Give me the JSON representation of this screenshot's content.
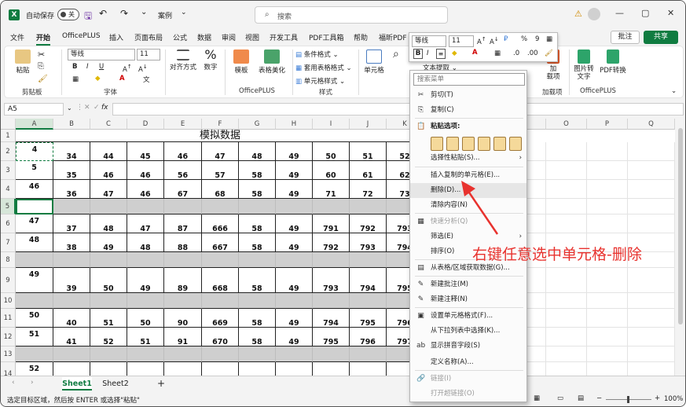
{
  "app": {
    "autosave_label": "自动保存",
    "autosave_state": "关",
    "file_name": "案例",
    "search_placeholder": "搜索",
    "window_buttons": [
      "—",
      "▢",
      "✕"
    ]
  },
  "menu": {
    "items": [
      "文件",
      "开始",
      "OfficePLUS",
      "插入",
      "页面布局",
      "公式",
      "数据",
      "审阅",
      "视图",
      "开发工具",
      "PDF工具箱",
      "帮助",
      "福昕PDF"
    ],
    "active": "开始",
    "comment_label": "批注",
    "share_label": "共享"
  },
  "ribbon": {
    "paste_label": "粘贴",
    "clipboard_label": "剪贴板",
    "font_name": "等线",
    "font_size": "11",
    "font_label": "字体",
    "alignment_label": "对齐方式",
    "number_label": "数字",
    "template_label": "模板",
    "table_beautify_label": "表格美化",
    "officeplus_label": "OfficePLUS",
    "conditional_format": "条件格式",
    "table_format": "套用表格格式",
    "cell_style": "单元格样式",
    "styles_label": "样式",
    "cells_label": "单元格",
    "text_extract": "文本提取",
    "load_items": "加\n载项",
    "load_items_label": "加载项",
    "image_to_text": "图片转\n文字",
    "pdf_convert": "PDF转换",
    "officeplus_label2": "OfficePLUS"
  },
  "mini_toolbar": {
    "font_name": "等线",
    "font_size": "11",
    "bold": "B",
    "italic": "I"
  },
  "formula_bar": {
    "name_box": "A5",
    "fx": "fx"
  },
  "sheet": {
    "columns": [
      "A",
      "B",
      "C",
      "D",
      "E",
      "F",
      "G",
      "H",
      "I",
      "J",
      "K",
      "L",
      "M",
      "N",
      "O",
      "P",
      "Q"
    ],
    "title": "模拟数据",
    "rows": [
      {
        "num": "1",
        "type": "title",
        "values": []
      },
      {
        "num": "2",
        "type": "data",
        "values": [
          "4",
          "34",
          "44",
          "45",
          "46",
          "47",
          "48",
          "49",
          "50",
          "51",
          "52"
        ]
      },
      {
        "num": "3",
        "type": "data",
        "values": [
          "5",
          "35",
          "46",
          "46",
          "56",
          "57",
          "58",
          "49",
          "60",
          "61",
          "62"
        ]
      },
      {
        "num": "4",
        "type": "data",
        "values": [
          "46",
          "36",
          "47",
          "46",
          "67",
          "68",
          "58",
          "49",
          "71",
          "72",
          "73"
        ]
      },
      {
        "num": "5",
        "type": "gray",
        "values": []
      },
      {
        "num": "6",
        "type": "data",
        "values": [
          "47",
          "37",
          "48",
          "47",
          "87",
          "666",
          "58",
          "49",
          "791",
          "792",
          "793"
        ]
      },
      {
        "num": "7",
        "type": "data",
        "values": [
          "48",
          "38",
          "49",
          "48",
          "88",
          "667",
          "58",
          "49",
          "792",
          "793",
          "794"
        ]
      },
      {
        "num": "8",
        "type": "gray",
        "values": []
      },
      {
        "num": "9",
        "type": "data",
        "values": [
          "49",
          "39",
          "50",
          "49",
          "89",
          "668",
          "58",
          "49",
          "793",
          "794",
          "795"
        ]
      },
      {
        "num": "10",
        "type": "gray",
        "values": []
      },
      {
        "num": "11",
        "type": "data",
        "values": [
          "50",
          "40",
          "51",
          "50",
          "90",
          "669",
          "58",
          "49",
          "794",
          "795",
          "796"
        ]
      },
      {
        "num": "12",
        "type": "data",
        "values": [
          "51",
          "41",
          "52",
          "51",
          "91",
          "670",
          "58",
          "49",
          "795",
          "796",
          "797"
        ]
      },
      {
        "num": "13",
        "type": "gray",
        "values": []
      },
      {
        "num": "14",
        "type": "data",
        "values": [
          "52",
          "42",
          "53",
          "52",
          "92",
          "671",
          "58",
          "49",
          "796",
          "797",
          "798"
        ]
      }
    ]
  },
  "context_menu": {
    "search_placeholder": "搜索菜单",
    "items": [
      {
        "label": "剪切(T)",
        "icon": "✂",
        "name": "cut"
      },
      {
        "label": "复制(C)",
        "icon": "⎘",
        "name": "copy"
      },
      {
        "label": "粘贴选项:",
        "icon": "📋",
        "name": "paste-options",
        "bold": true
      },
      {
        "label": "选择性粘贴(S)...",
        "icon": "",
        "name": "paste-special",
        "arrow": "›"
      },
      {
        "label": "插入复制的单元格(E)...",
        "icon": "",
        "name": "insert-copied-cells"
      },
      {
        "label": "删除(D)...",
        "icon": "",
        "name": "delete",
        "hover": true
      },
      {
        "label": "清除内容(N)",
        "icon": "",
        "name": "clear-contents"
      },
      {
        "label": "快速分析(Q)",
        "icon": "▦",
        "name": "quick-analysis",
        "disabled": true
      },
      {
        "label": "筛选(E)",
        "icon": "",
        "name": "filter",
        "arrow": "›"
      },
      {
        "label": "排序(O)",
        "icon": "",
        "name": "sort",
        "arrow": "›"
      },
      {
        "label": "从表格/区域获取数据(G)...",
        "icon": "▤",
        "name": "get-data"
      },
      {
        "label": "新建批注(M)",
        "icon": "✎",
        "name": "new-comment"
      },
      {
        "label": "新建注释(N)",
        "icon": "✎",
        "name": "new-note"
      },
      {
        "label": "设置单元格格式(F)...",
        "icon": "▣",
        "name": "format-cells"
      },
      {
        "label": "从下拉列表中选择(K)...",
        "icon": "",
        "name": "pick-from-list"
      },
      {
        "label": "显示拼音字段(S)",
        "icon": "ab",
        "name": "phonetic"
      },
      {
        "label": "定义名称(A)...",
        "icon": "",
        "name": "define-name"
      },
      {
        "label": "链接(I)",
        "icon": "🔗",
        "name": "link",
        "disabled": true
      },
      {
        "label": "打开超链接(O)",
        "icon": "",
        "name": "open-hyperlink",
        "disabled": true
      }
    ]
  },
  "annotation": "右键任意选中单元格-删除",
  "tabs": {
    "sheets": [
      "Sheet1",
      "Sheet2"
    ],
    "active": "Sheet1",
    "add": "+"
  },
  "status": {
    "message": "选定目标区域，然后按 ENTER 或选择\"粘贴\"",
    "zoom": "100%"
  },
  "colors": {
    "excel_green": "#107c41",
    "gray_row": "#cfcfcf",
    "annotation_red": "#e8322e"
  }
}
